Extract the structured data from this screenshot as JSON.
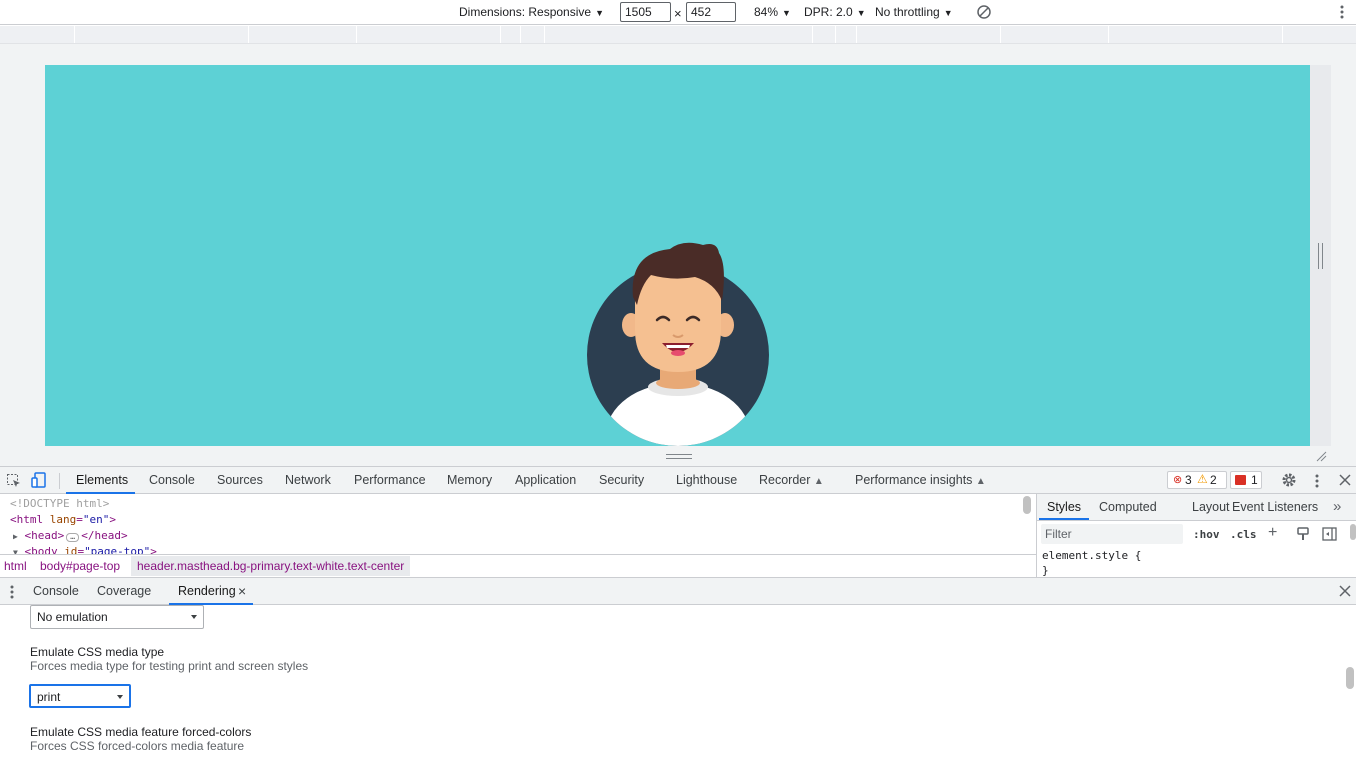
{
  "device_toolbar": {
    "dimensions_label": "Dimensions: Responsive",
    "width": "1505",
    "times": "×",
    "height": "452",
    "zoom": "84%",
    "dpr": "DPR: 2.0",
    "throttling": "No throttling"
  },
  "devtools_tabs": [
    "Elements",
    "Console",
    "Sources",
    "Network",
    "Performance",
    "Memory",
    "Application",
    "Security",
    "Lighthouse",
    "Recorder",
    "Performance insights"
  ],
  "counters": {
    "errors": "3",
    "warnings": "2",
    "issues": "1"
  },
  "elements": {
    "lines": [
      "<!DOCTYPE html>",
      "<html lang=\"en\">",
      "<head>",
      "</head>",
      "<body id=\"page-top\">"
    ]
  },
  "breadcrumbs": [
    "html",
    "body#page-top",
    "header.masthead.bg-primary.text-white.text-center"
  ],
  "styles_tabs": [
    "Styles",
    "Computed",
    "Layout",
    "Event Listeners"
  ],
  "styles": {
    "filter_placeholder": "Filter",
    "hov": ":hov",
    "cls": ".cls",
    "rule_selector": "element.style {",
    "rule_close": "}"
  },
  "drawer_tabs": [
    "Console",
    "Coverage",
    "Rendering"
  ],
  "rendering": {
    "select1_value": "No emulation",
    "media_type_title": "Emulate CSS media type",
    "media_type_desc": "Forces media type for testing print and screen styles",
    "media_type_value": "print",
    "forced_colors_title": "Emulate CSS media feature forced-colors",
    "forced_colors_desc": "Forces CSS forced-colors media feature"
  },
  "colors": {
    "masthead": "#5dd1d5",
    "avatar_bg": "#2c3e50",
    "accent": "#1a73e8"
  }
}
